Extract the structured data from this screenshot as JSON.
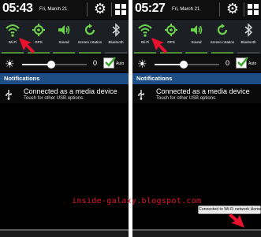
{
  "screens": [
    {
      "time": "05:43",
      "date": "Fri, March 21",
      "toggles": [
        {
          "label": "Wi-Fi",
          "icon": "wifi-icon",
          "on": true
        },
        {
          "label": "GPS",
          "icon": "gps-icon",
          "on": true
        },
        {
          "label": "Sound",
          "icon": "sound-icon",
          "on": true
        },
        {
          "label": "Screen rotation",
          "icon": "screen-rotation-icon",
          "on": true
        },
        {
          "label": "Bluetooth",
          "icon": "bluetooth-icon",
          "on": false
        }
      ],
      "brightness": {
        "level": "0",
        "auto_label": "Auto",
        "auto_checked": true,
        "fill": 0.45
      },
      "notifications_header": "Notifications",
      "notification": {
        "title": "Connected as a media device",
        "subtitle": "Touch for other USB options."
      }
    },
    {
      "time": "05:27",
      "date": "Fri, March 21",
      "toggles": [
        {
          "label": "Wi-Fi",
          "icon": "wifi-icon",
          "on": true
        },
        {
          "label": "GPS",
          "icon": "gps-icon",
          "on": true
        },
        {
          "label": "Sound",
          "icon": "sound-icon",
          "on": true
        },
        {
          "label": "Screen rotation",
          "icon": "screen-rotation-icon",
          "on": true
        },
        {
          "label": "Bluetooth",
          "icon": "bluetooth-icon",
          "on": false
        }
      ],
      "brightness": {
        "level": "0",
        "auto_label": "Auto",
        "auto_checked": true,
        "fill": 0.45
      },
      "notifications_header": "Notifications",
      "notification": {
        "title": "Connected as a media device",
        "subtitle": "Touch for other USB options."
      },
      "toast": "Connected to Wi-Fi network Home."
    }
  ],
  "watermark": "inside-galaxy.blogspot.com",
  "colors": {
    "toggle_active": "#4c8d2f",
    "notifications_header": "#1d4f86",
    "arrow": "#e8122e"
  }
}
